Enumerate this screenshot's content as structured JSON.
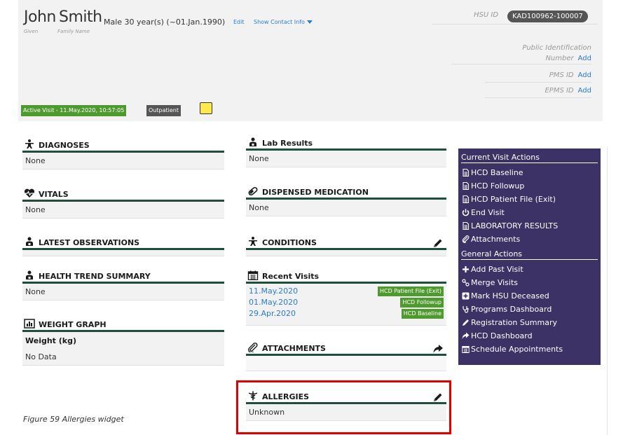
{
  "patient": {
    "given_name": "John",
    "family_name": "Smith",
    "given_label": "Given",
    "family_label": "Family Name",
    "demographics": "Male  30 year(s) (~01.Jan.1990)",
    "edit_link": "Edit",
    "contact_link": "Show Contact Info"
  },
  "identifiers": {
    "hsu_label": "HSU ID",
    "hsu_value": "KAD100962-100007",
    "public_id_label_1": "Public Identification",
    "public_id_label_2": "Number",
    "pms_label": "PMS ID",
    "epms_label": "EPMS ID",
    "add_label": "Add"
  },
  "visit": {
    "active_visit": "Active Visit - 11.May.2020, 10:57:05",
    "visit_type": "Outpatient"
  },
  "widgets": {
    "diagnoses": {
      "title": "DIAGNOSES",
      "value": "None"
    },
    "vitals": {
      "title": "VITALS",
      "value": "None"
    },
    "observations": {
      "title": "LATEST OBSERVATIONS"
    },
    "trend": {
      "title": "HEALTH TREND SUMMARY",
      "value": "None"
    },
    "weight": {
      "title": "WEIGHT GRAPH",
      "subtitle": "Weight (kg)",
      "value": "No Data"
    },
    "lab": {
      "title": "Lab Results",
      "value": "None"
    },
    "dispensed": {
      "title": "DISPENSED MEDICATION",
      "value": "None"
    },
    "conditions": {
      "title": "CONDITIONS"
    },
    "recent": {
      "title": "Recent Visits",
      "visits": [
        {
          "date": "11.May.2020",
          "type": "HCD Patient File (Exit)"
        },
        {
          "date": "01.May.2020",
          "type": "HCD Followup"
        },
        {
          "date": "29.Apr.2020",
          "type": "HCD Baseline"
        }
      ]
    },
    "attachments": {
      "title": "ATTACHMENTS"
    },
    "allergies": {
      "title": "ALLERGIES",
      "value": "Unknown"
    }
  },
  "actions": {
    "current_title": "Current Visit Actions",
    "current": [
      {
        "label": "HCD Baseline",
        "icon": "document-icon"
      },
      {
        "label": "HCD Followup",
        "icon": "document-icon"
      },
      {
        "label": "HCD Patient File (Exit)",
        "icon": "document-icon"
      },
      {
        "label": "End Visit",
        "icon": "power-icon"
      },
      {
        "label": "LABORATORY RESULTS",
        "icon": "document-icon"
      },
      {
        "label": "Attachments",
        "icon": "paperclip-icon"
      }
    ],
    "general_title": "General Actions",
    "general": [
      {
        "label": "Add Past Visit",
        "icon": "plus-icon"
      },
      {
        "label": "Merge Visits",
        "icon": "link-icon"
      },
      {
        "label": "Mark HSU Deceased",
        "icon": "plus-square-icon"
      },
      {
        "label": "Programs Dashboard",
        "icon": "stethoscope-icon"
      },
      {
        "label": "Registration Summary",
        "icon": "pencil-icon"
      },
      {
        "label": "HCD Dashboard",
        "icon": "share-icon"
      },
      {
        "label": "Schedule Appointments",
        "icon": "calendar-icon"
      }
    ]
  },
  "caption": "Figure 59 Allergies widget",
  "colors": {
    "header_bg": "#f2f2f2",
    "widget_rule": "#1f4f3a",
    "link": "#2a7ccf",
    "badge_green": "#4f9a2f",
    "badge_gray": "#555555",
    "panel_bg": "#3d3266",
    "highlight": "#e00000",
    "sticky": "#ffe94f"
  }
}
